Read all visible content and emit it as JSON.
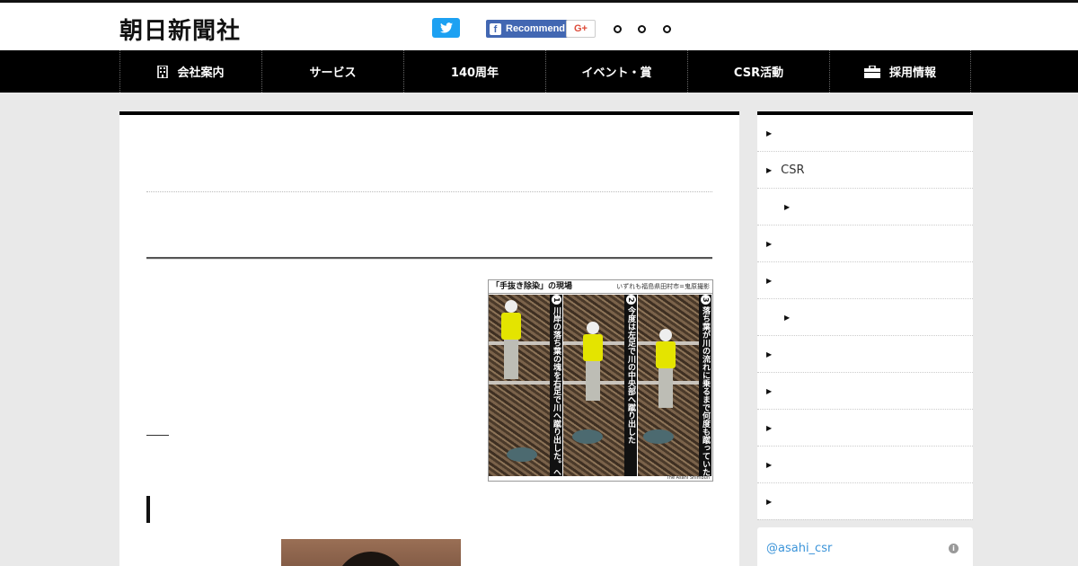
{
  "header": {
    "logo_text": "朝日新聞社",
    "share": {
      "twitter_icon": "twitter-bird-icon",
      "facebook_label": "Recommend",
      "googleplus_label": "G+"
    }
  },
  "nav": {
    "items": [
      {
        "label": "会社案内",
        "icon": "building-icon"
      },
      {
        "label": "サービス"
      },
      {
        "label": "140周年"
      },
      {
        "label": "イベント・賞"
      },
      {
        "label": "CSR活動"
      },
      {
        "label": "採用情報",
        "icon": "briefcase-icon"
      }
    ]
  },
  "article": {
    "photo": {
      "title": "「手抜き除染」の現場",
      "subtitle": "いずれも福島県田村市=鬼原撮影",
      "captions": [
        {
          "num": "1",
          "text": "川岸の落ち葉の塊を右足で川へ蹴り出した。ヘルメットのピンクのラインは現場責任者の印だ"
        },
        {
          "num": "2",
          "text": "今度は左足で川の中央部へ蹴り出した"
        },
        {
          "num": "3",
          "text": "落ち葉が川の流れに乗るまで何度も蹴っていた"
        }
      ],
      "credit": "The Asahi Shimbun"
    }
  },
  "sidebar": {
    "items": [
      {
        "label": "",
        "level": 0
      },
      {
        "label": "CSR",
        "level": 0
      },
      {
        "label": "",
        "level": 1
      },
      {
        "label": "",
        "level": 0
      },
      {
        "label": "",
        "level": 0
      },
      {
        "label": "",
        "level": 1
      },
      {
        "label": "",
        "level": 0
      },
      {
        "label": "",
        "level": 0
      },
      {
        "label": "",
        "level": 0
      },
      {
        "label": "",
        "level": 0
      },
      {
        "label": "",
        "level": 0
      }
    ]
  },
  "twitter_widget": {
    "handle": "@asahi_csr",
    "info_icon": "info-icon"
  },
  "colors": {
    "nav_bg": "#000000",
    "twitter": "#1da1f2",
    "facebook": "#4267b2",
    "googleplus": "#dd4b39",
    "link": "#3b94d9"
  }
}
